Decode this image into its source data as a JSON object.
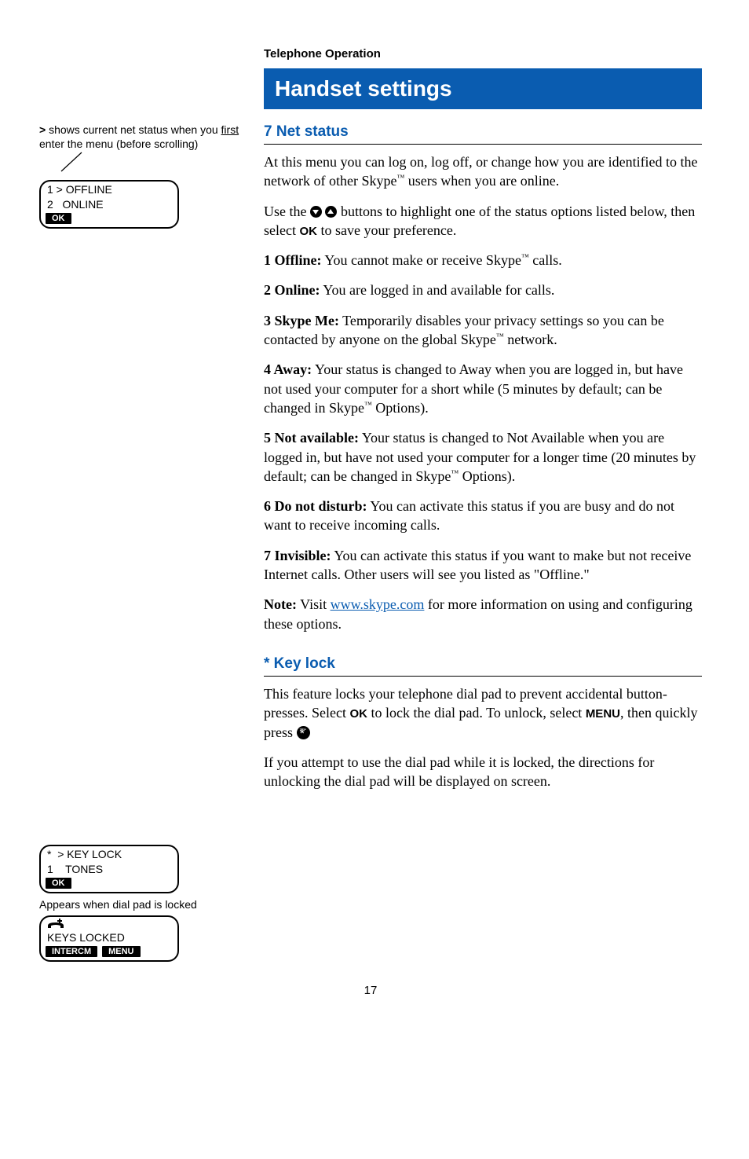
{
  "top_heading": "Telephone Operation",
  "banner": " Handset settings",
  "left": {
    "note_prefix": "> ",
    "note_1a": "shows current net status when you ",
    "note_1b_underlined": "first",
    "note_1c": " enter the menu (before scrolling)",
    "lcd1_line1": "1 > OFFLINE",
    "lcd1_line2": "2   ONLINE",
    "lcd1_soft": "OK",
    "lcd2_line1": "*  > KEY LOCK",
    "lcd2_line2": "1    TONES",
    "lcd2_soft": "OK",
    "caption_locked": "Appears when dial pad is locked",
    "lcd3_line2": "KEYS LOCKED",
    "lcd3_soft_left": "INTERCM",
    "lcd3_soft_right": "MENU"
  },
  "net_status": {
    "title": "7 Net status",
    "p1a": "At this menu you can log on, log off, or change how you are identified to the network of other Skype",
    "p1b": " users when you are online.",
    "p2a": "Use the ",
    "p2b": " buttons to highlight one of the status options listed below, then select ",
    "p2_ok": "OK",
    "p2c": " to save your preference.",
    "opt1_label": "1 Offline:",
    "opt1_text_a": " You cannot make or receive Skype",
    "opt1_text_b": " calls.",
    "opt2_label": "2 Online:",
    "opt2_text": " You are logged in and available for calls.",
    "opt3_label": "3 Skype Me:",
    "opt3_text_a": " Temporarily disables your privacy settings so you can be contacted by anyone on the global Skype",
    "opt3_text_b": " network.",
    "opt4_label": "4 Away:",
    "opt4_text_a": " Your status is changed to Away when you are logged in, but have not used your computer for a short while (5 minutes by default; can be changed in Skype",
    "opt4_text_b": " Options).",
    "opt5_label": "5 Not available:",
    "opt5_text_a": " Your status is changed to Not Available when you are logged in, but have not used your computer for a longer time (20 minutes by default; can be changed in Skype",
    "opt5_text_b": " Options).",
    "opt6_label": "6 Do not disturb:",
    "opt6_text": " You can activate this status if you are busy and do not want to receive incoming calls.",
    "opt7_label": "7 Invisible:",
    "opt7_text": " You can activate this status if you want to make but not receive Internet calls. Other users will see you listed as \"Offline.\"",
    "note_label": "Note:",
    "note_a": " Visit ",
    "note_link": "www.skype.com",
    "note_b": " for more information on using and configuring these options."
  },
  "keylock": {
    "title": "* Key lock",
    "p1a": "This feature locks your telephone dial pad to prevent accidental button-presses. Select ",
    "p1_ok": "OK",
    "p1b": " to lock the dial pad. To unlock, select ",
    "p1_menu": "MENU",
    "p1c": ", then quickly press ",
    "p2": "If you attempt to use the dial pad while it is locked, the directions for unlocking the dial pad will be displayed on screen."
  },
  "page_number": "17",
  "tm": "™"
}
